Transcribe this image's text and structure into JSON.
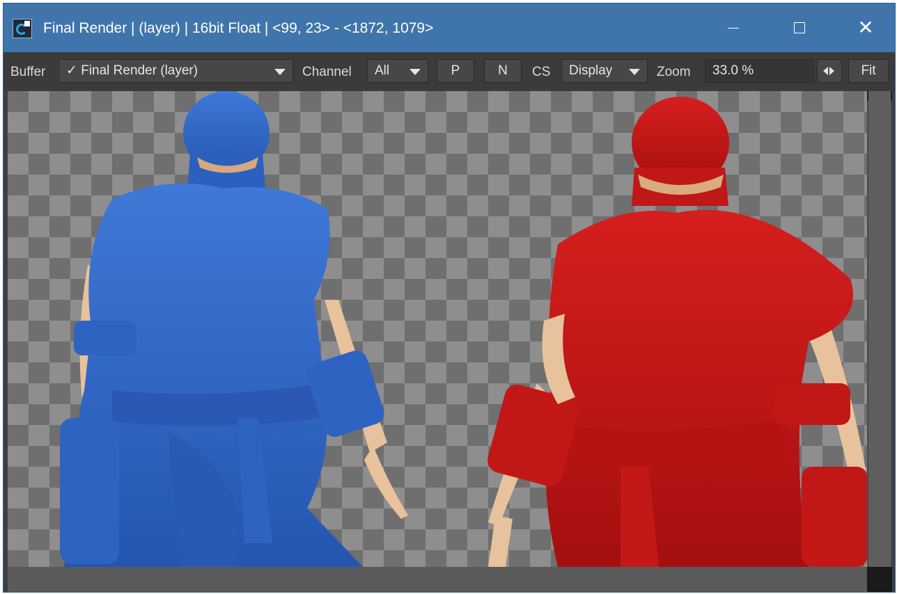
{
  "window": {
    "title": "Final Render | (layer) | 16bit Float | <99, 23> - <1872, 1079>",
    "controls": {
      "minimize": "minimize",
      "maximize": "maximize",
      "close": "✕"
    }
  },
  "toolbar": {
    "buffer_label": "Buffer",
    "buffer_value": "✓ Final Render (layer)",
    "channel_label": "Channel",
    "channel_value": "All",
    "p_button": "P",
    "n_button": "N",
    "cs_label": "CS",
    "cs_value": "Display",
    "zoom_label": "Zoom",
    "zoom_value": "33.0 %",
    "fit_button": "Fit"
  },
  "colors": {
    "titlebar": "#3f75ab",
    "toolbar": "#3b3b3b",
    "checker_light": "#8e8e8e",
    "checker_dark": "#6f6f6f",
    "blue_ninja": "#2f64c7",
    "red_ninja": "#c11414",
    "skin": "#e8c29c"
  },
  "viewport": {
    "content": [
      "blue-ninja-render",
      "red-ninja-render"
    ]
  }
}
